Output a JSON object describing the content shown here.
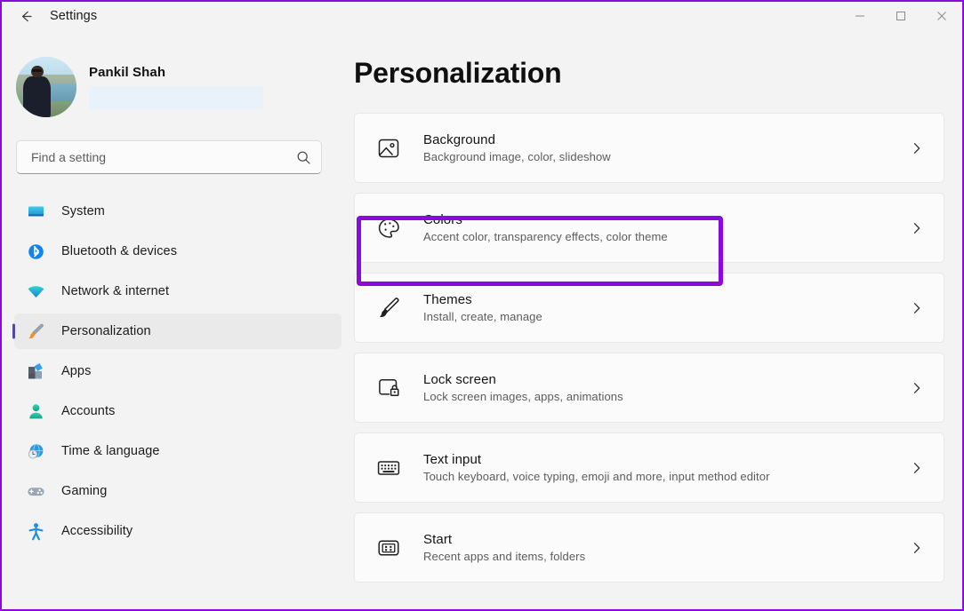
{
  "window": {
    "title": "Settings",
    "back_icon": "back-arrow-icon",
    "controls": {
      "minimize": "minimize-icon",
      "maximize": "maximize-icon",
      "close": "close-icon"
    },
    "highlight_color": "#8A09DC",
    "background_color": "#F3F3F3",
    "card_color": "#FBFBFB"
  },
  "sidebar": {
    "account": {
      "name": "Pankil Shah",
      "email_redacted": true,
      "avatar_icon": "user-avatar-photo"
    },
    "search": {
      "placeholder": "Find a setting",
      "value": "",
      "icon": "search-icon"
    },
    "items": [
      {
        "label": "System",
        "icon": "monitor-icon",
        "selected": false
      },
      {
        "label": "Bluetooth & devices",
        "icon": "bluetooth-icon",
        "selected": false
      },
      {
        "label": "Network & internet",
        "icon": "wifi-icon",
        "selected": false
      },
      {
        "label": "Personalization",
        "icon": "paintbrush-icon",
        "selected": true
      },
      {
        "label": "Apps",
        "icon": "apps-icon",
        "selected": false
      },
      {
        "label": "Accounts",
        "icon": "person-icon",
        "selected": false
      },
      {
        "label": "Time & language",
        "icon": "clock-globe-icon",
        "selected": false
      },
      {
        "label": "Gaming",
        "icon": "gamepad-icon",
        "selected": false
      },
      {
        "label": "Accessibility",
        "icon": "accessibility-icon",
        "selected": false
      }
    ]
  },
  "main": {
    "title": "Personalization",
    "cards": [
      {
        "title": "Background",
        "subtitle": "Background image, color, slideshow",
        "icon": "picture-icon",
        "chevron": "chevron-right-icon",
        "highlighted": false
      },
      {
        "title": "Colors",
        "subtitle": "Accent color, transparency effects, color theme",
        "icon": "palette-icon",
        "chevron": "chevron-right-icon",
        "highlighted": true
      },
      {
        "title": "Themes",
        "subtitle": "Install, create, manage",
        "icon": "paintbrush-icon",
        "chevron": "chevron-right-icon",
        "highlighted": false
      },
      {
        "title": "Lock screen",
        "subtitle": "Lock screen images, apps, animations",
        "icon": "lock-screen-icon",
        "chevron": "chevron-right-icon",
        "highlighted": false
      },
      {
        "title": "Text input",
        "subtitle": "Touch keyboard, voice typing, emoji and more, input method editor",
        "icon": "keyboard-icon",
        "chevron": "chevron-right-icon",
        "highlighted": false
      },
      {
        "title": "Start",
        "subtitle": "Recent apps and items, folders",
        "icon": "start-menu-icon",
        "chevron": "chevron-right-icon",
        "highlighted": false
      }
    ]
  }
}
